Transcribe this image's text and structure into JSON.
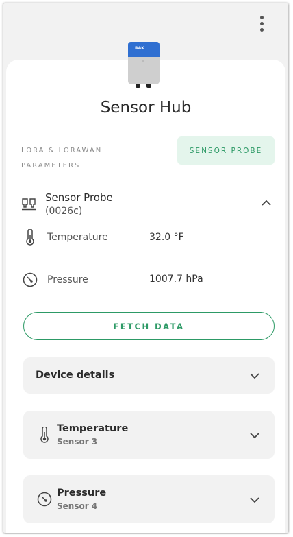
{
  "header": {
    "menu_icon": "kebab-menu-icon"
  },
  "device": {
    "logo_text": "RAK",
    "title": "Sensor Hub"
  },
  "tabs": [
    {
      "label": "LORA & LORAWAN PARAMETERS",
      "active": false
    },
    {
      "label": "SENSOR PROBE",
      "active": true
    }
  ],
  "probe": {
    "name": "Sensor Probe",
    "id": "(0026c)",
    "readings": [
      {
        "icon": "thermometer-icon",
        "label": "Temperature",
        "value": "32.0 °F"
      },
      {
        "icon": "gauge-icon",
        "label": "Pressure",
        "value": "1007.7 hPa"
      }
    ]
  },
  "actions": {
    "fetch_label": "FETCH DATA"
  },
  "cards": [
    {
      "title": "Device details",
      "subtitle": ""
    },
    {
      "icon": "thermometer-icon",
      "title": "Temperature",
      "subtitle": "Sensor 3"
    },
    {
      "icon": "gauge-icon",
      "title": "Pressure",
      "subtitle": "Sensor 4"
    }
  ],
  "colors": {
    "accent": "#2d9a66",
    "accent_bg": "#e4f5ec",
    "device_blue": "#2f6fd1"
  }
}
